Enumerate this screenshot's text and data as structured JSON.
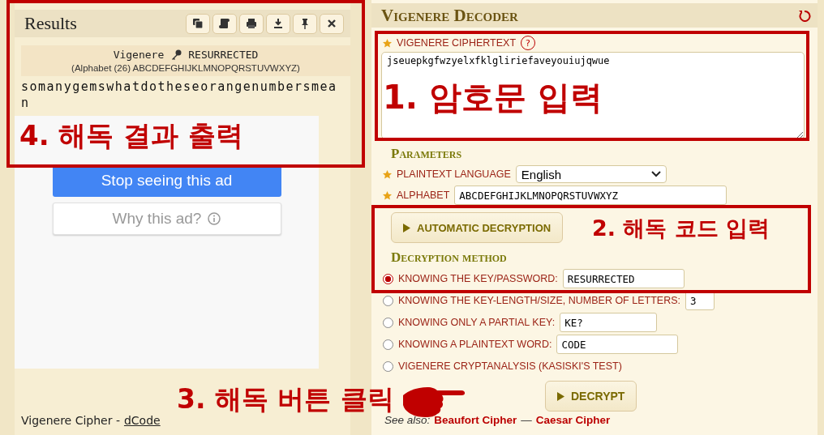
{
  "results": {
    "title": "Results",
    "summary": {
      "cipher": "Vigenere",
      "key": "RESURRECTED",
      "alphabet_note": "(Alphabet (26) ABCDEFGHIJKLMNOPQRSTUVWXYZ)"
    },
    "plaintext": "somanygemswhatdotheseorangenumbersmean"
  },
  "ad": {
    "buttons": [
      {
        "label": "Stop seeing this ad",
        "kind": "primary"
      },
      {
        "label": "Why this ad?",
        "kind": "secondary"
      }
    ]
  },
  "footer": {
    "text": "Vigenere Cipher -",
    "link": "dCode"
  },
  "decoder": {
    "title": "Vigenere Decoder",
    "ciphertext": {
      "label": "VIGENERE CIPHERTEXT",
      "help": "?",
      "value": "jseuepkgfwzyelxfklgliriefaveyouiujqwue"
    },
    "parameters": {
      "heading": "Parameters",
      "language": {
        "label": "PLAINTEXT LANGUAGE",
        "value": "English"
      },
      "alphabet": {
        "label": "ALPHABET",
        "value": "ABCDEFGHIJKLMNOPQRSTUVWXYZ"
      }
    },
    "auto_button": "AUTOMATIC DECRYPTION",
    "method": {
      "heading": "Decryption method",
      "options": [
        {
          "label": "KNOWING THE KEY/PASSWORD:",
          "value": "RESURRECTED",
          "selected": true,
          "kind": "wide"
        },
        {
          "label": "KNOWING THE KEY-LENGTH/SIZE, NUMBER OF LETTERS:",
          "value": "3",
          "selected": false,
          "kind": "short"
        },
        {
          "label": "KNOWING ONLY A PARTIAL KEY:",
          "value": "KE?",
          "selected": false,
          "kind": "medium"
        },
        {
          "label": "KNOWING A PLAINTEXT WORD:",
          "value": "CODE",
          "selected": false,
          "kind": "wide"
        },
        {
          "label": "VIGENERE CRYPTANALYSIS (KASISKI'S TEST)",
          "selected": false,
          "kind": "none"
        }
      ]
    },
    "decrypt_button": "DECRYPT",
    "see_also": {
      "label": "See also:",
      "links": [
        "Beaufort Cipher",
        "Caesar Cipher"
      ],
      "separator": "—"
    }
  },
  "annotations": [
    "1. 암호문 입력",
    "2. 해독 코드 입력",
    "3. 해독 버튼 클릭",
    "4. 해독 결과 출력"
  ]
}
